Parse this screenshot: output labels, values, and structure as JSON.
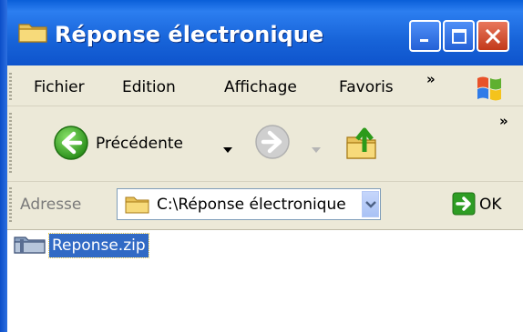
{
  "window": {
    "title": "Réponse électronique",
    "title_icon": "folder-icon",
    "controls": [
      "minimize-icon",
      "maximize-icon",
      "close-icon"
    ],
    "colors": {
      "titlebar": "#0a5fd8",
      "close": "#c2391a",
      "selection": "#316ac5",
      "chrome": "#ece9d8"
    }
  },
  "menubar": {
    "items": [
      "Fichier",
      "Edition",
      "Affichage",
      "Favoris"
    ],
    "overflow": "»"
  },
  "toolbar": {
    "back_label": "Précédente",
    "overflow": "»"
  },
  "address": {
    "label": "Adresse",
    "value": "C:\\Réponse électronique",
    "go_label": "OK"
  },
  "content": {
    "files": [
      {
        "name": "Reponse.zip",
        "icon": "zip-folder-icon",
        "selected": true
      }
    ]
  }
}
